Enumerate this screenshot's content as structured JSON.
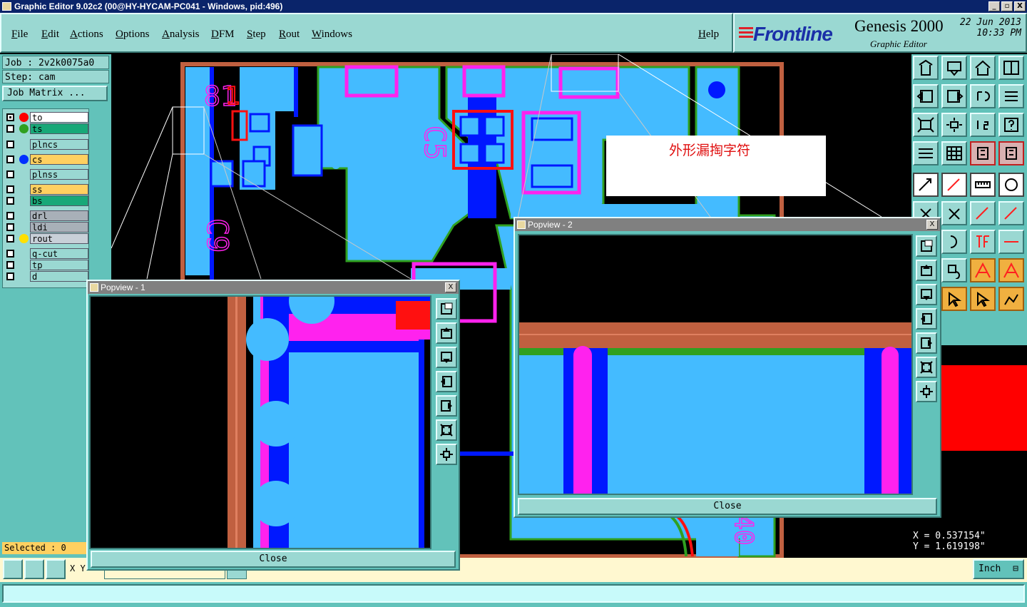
{
  "window": {
    "title": "Graphic Editor 9.02c2 (00@HY-HYCAM-PC041 - Windows, pid:496)",
    "controls": [
      "_",
      "▫",
      "X"
    ]
  },
  "menu": [
    "File",
    "Edit",
    "Actions",
    "Options",
    "Analysis",
    "DFM",
    "Step",
    "Rout",
    "Windows"
  ],
  "help": "Help",
  "logo": {
    "brand": "Frontline",
    "product": "Genesis 2000",
    "subtitle": "Graphic Editor",
    "date": "22 Jun 2013",
    "time": "10:33 PM"
  },
  "job": {
    "job_line": "Job : 2v2k0075a0",
    "step_line": "Step: cam",
    "matrix": "Job Matrix ..."
  },
  "layers": [
    {
      "name": "to",
      "color": "#ffffff",
      "dot": "#ff0000",
      "checked": true
    },
    {
      "name": "ts",
      "color": "#18a878",
      "dot": "#30a020",
      "checked": false
    },
    {
      "name": "plncs",
      "color": "#9ad8d2",
      "dot": "",
      "checked": false
    },
    {
      "name": "cs",
      "color": "#ffd060",
      "dot": "#0030ff",
      "checked": false
    },
    {
      "name": "plnss",
      "color": "#9ad8d2",
      "dot": "",
      "checked": false
    },
    {
      "name": "ss",
      "color": "#ffd060",
      "dot": "",
      "checked": false
    },
    {
      "name": "bs",
      "color": "#18a878",
      "dot": "",
      "checked": false
    },
    {
      "name": "drl",
      "color": "#a8b0b8",
      "dot": "",
      "checked": false
    },
    {
      "name": "ldi",
      "color": "#a8b0b8",
      "dot": "",
      "checked": false
    },
    {
      "name": "rout",
      "color": "#c8d0d8",
      "dot": "#ffe000",
      "checked": false
    },
    {
      "name": "q-cut",
      "color": "#9ad8d2",
      "dot": "",
      "checked": false
    },
    {
      "name": "tp",
      "color": "#9ad8d2",
      "dot": "",
      "checked": false
    },
    {
      "name": "d",
      "color": "#9ad8d2",
      "dot": "",
      "checked": false
    }
  ],
  "selected": "Selected : 0",
  "annotation": "外形漏掏字符",
  "popview1": {
    "title": "Popview - 1",
    "close": "Close"
  },
  "popview2": {
    "title": "Popview - 2",
    "close": "Close"
  },
  "coords": {
    "x": "X = 0.537154\"",
    "y": "Y = 1.619198\""
  },
  "bottom": {
    "xy": "X Y",
    "units": "Inch"
  },
  "colors": {
    "copper": "#44bbff",
    "mask": "#0018ff",
    "silk": "#ff22ee",
    "outline": "#c06040",
    "green": "#30a020",
    "red": "#ff1010"
  }
}
